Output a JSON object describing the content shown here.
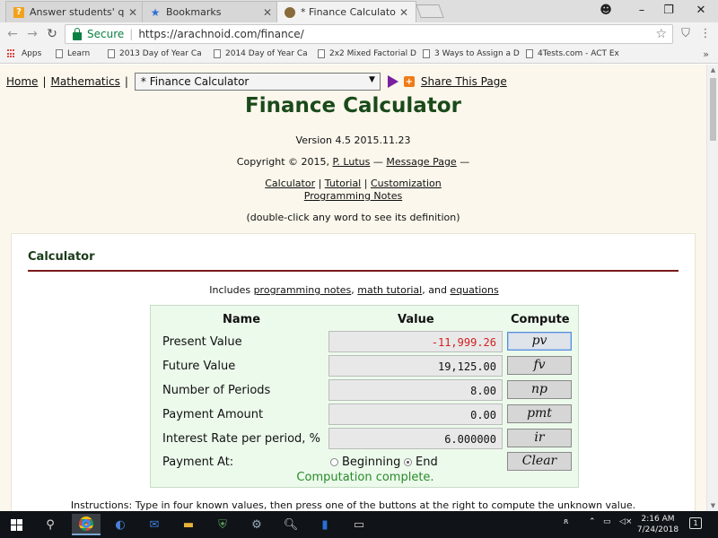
{
  "browser": {
    "tabs": [
      {
        "title": "Answer students' questio",
        "icon": "answer-site-favicon",
        "active": false
      },
      {
        "title": "Bookmarks",
        "icon": "star-icon",
        "active": false
      },
      {
        "title": "* Finance Calculator",
        "icon": "arachnoid-favicon",
        "active": true
      }
    ],
    "secure_label": "Secure",
    "url": "https://arachnoid.com/finance/",
    "bookmarks": [
      {
        "label": "Apps"
      },
      {
        "label": "Learn"
      },
      {
        "label": "2013 Day of Year Ca"
      },
      {
        "label": "2014 Day of Year Ca"
      },
      {
        "label": "2x2 Mixed Factorial D"
      },
      {
        "label": "3 Ways to Assign a D"
      },
      {
        "label": "4Tests.com - ACT Ex"
      }
    ],
    "more_label": "»"
  },
  "page": {
    "nav": {
      "home": "Home",
      "math": "Mathematics",
      "pipe": "|",
      "select_value": "* Finance Calculator",
      "share": "Share This Page"
    },
    "title": "Finance Calculator",
    "version": "Version 4.5 2015.11.23",
    "copyright_prefix": "Copyright © 2015, ",
    "author": "P. Lutus",
    "dash": " — ",
    "message_page": "Message Page",
    "dash_end": " —",
    "links": {
      "calculator": "Calculator",
      "tutorial": "Tutorial",
      "customization": "Customization",
      "programming_notes": "Programming Notes",
      "sep": " | "
    },
    "dblclick_hint": "(double-click any word to see its definition)",
    "section_title": "Calculator",
    "includes": {
      "prefix": "Includes ",
      "prog": "programming notes",
      "comma": ", ",
      "math": "math tutorial",
      "and": ", and ",
      "eq": "equations"
    },
    "instructions": "Instructions: Type in four known values, then press one of the buttons at the right to compute the unknown value."
  },
  "calculator": {
    "headers": {
      "name": "Name",
      "value": "Value",
      "compute": "Compute"
    },
    "rows": [
      {
        "label": "Present Value",
        "value": "-11,999.26",
        "button": "pv",
        "negative": true
      },
      {
        "label": "Future Value",
        "value": "19,125.00",
        "button": "fv",
        "negative": false
      },
      {
        "label": "Number of Periods",
        "value": "8.00",
        "button": "np",
        "negative": false
      },
      {
        "label": "Payment Amount",
        "value": "0.00",
        "button": "pmt",
        "negative": false
      },
      {
        "label": "Interest Rate per period, %",
        "value": "6.000000",
        "button": "ir",
        "negative": false
      }
    ],
    "payment_at": {
      "label": "Payment At:",
      "options": [
        "Beginning",
        "End"
      ],
      "selected": "End"
    },
    "clear_label": "Clear",
    "status": "Computation complete."
  },
  "taskbar": {
    "time": "2:16 AM",
    "date": "7/24/2018",
    "notifications": "1"
  }
}
